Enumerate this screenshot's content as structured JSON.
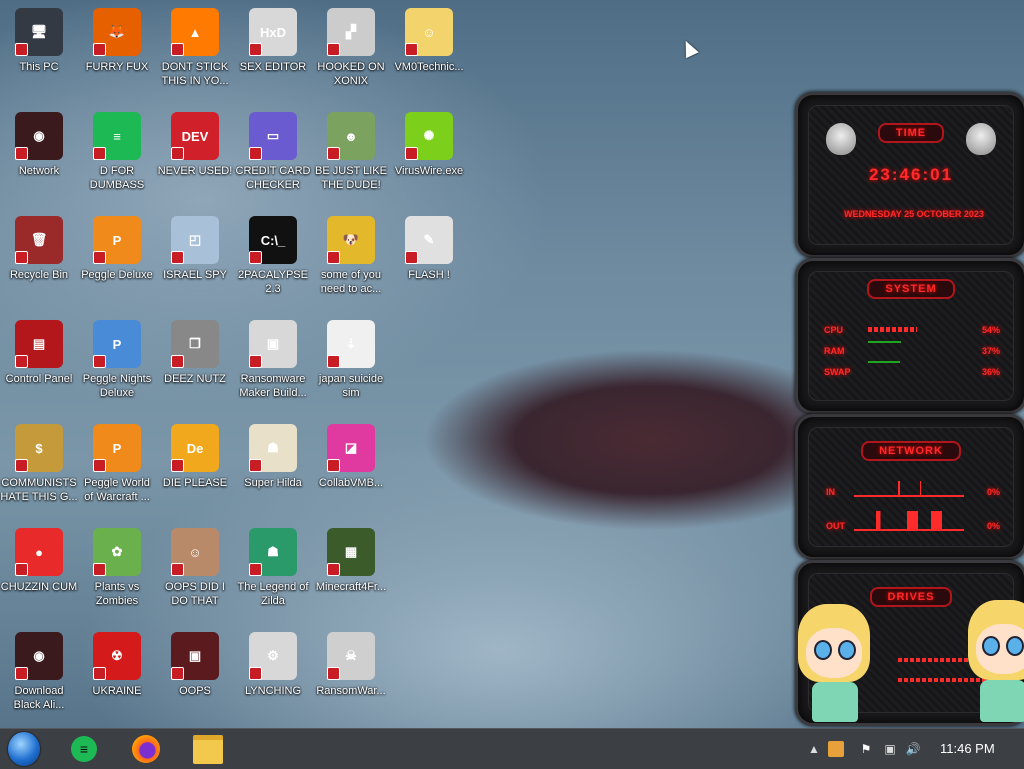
{
  "desktop_icons": [
    {
      "label": "This PC",
      "icon": "monitor-icon",
      "color": "#333a44",
      "glyph": "🖥"
    },
    {
      "label": "FURRY FUX",
      "icon": "firefox-icon",
      "color": "#e66000",
      "glyph": "🦊"
    },
    {
      "label": "DONT STICK THIS IN YO...",
      "icon": "traffic-cone-icon",
      "color": "#ff7a00",
      "glyph": "▲"
    },
    {
      "label": "SEX EDITOR",
      "icon": "hxd-icon",
      "color": "#d8d8d8",
      "glyph": "HxD"
    },
    {
      "label": "HOOKED ON XONIX",
      "icon": "xonix-icon",
      "color": "#cccccc",
      "glyph": "▞"
    },
    {
      "label": "VM0Technic...",
      "icon": "cartoon-icon",
      "color": "#f3d36b",
      "glyph": "☺"
    },
    {
      "label": "Network",
      "icon": "network-orb-icon",
      "color": "#3a1a1c",
      "glyph": "◉"
    },
    {
      "label": "D FOR DUMBASS",
      "icon": "discord-like-icon",
      "color": "#1db954",
      "glyph": "≡"
    },
    {
      "label": "NEVER USED!",
      "icon": "devcpp-icon",
      "color": "#d0212a",
      "glyph": "DEV"
    },
    {
      "label": "CREDIT CARD CHECKER",
      "icon": "credit-card-icon",
      "color": "#6b5bd0",
      "glyph": "▭"
    },
    {
      "label": "BE JUST LIKE THE DUDE!",
      "icon": "elf-icon",
      "color": "#7ba25f",
      "glyph": "☻"
    },
    {
      "label": "VirusWire.exe",
      "icon": "lime-icon",
      "color": "#7ccf1a",
      "glyph": "✺"
    },
    {
      "label": "Recycle Bin",
      "icon": "recycle-bin-icon",
      "color": "#9a2a2a",
      "glyph": "🗑"
    },
    {
      "label": "Peggle Deluxe",
      "icon": "peggle-icon",
      "color": "#f08a1a",
      "glyph": "P"
    },
    {
      "label": "ISRAEL SPY",
      "icon": "spy-icon",
      "color": "#a8c0d8",
      "glyph": "◰"
    },
    {
      "label": "2PACALYPSE 2.3",
      "icon": "terminal-icon",
      "color": "#111111",
      "glyph": "C:\\_"
    },
    {
      "label": "some of you need to ac...",
      "icon": "dog-icon",
      "color": "#e3b82a",
      "glyph": "🐶"
    },
    {
      "label": "FLASH !",
      "icon": "flash-icon",
      "color": "#e0e0e0",
      "glyph": "✎"
    },
    {
      "label": "Control Panel",
      "icon": "control-panel-icon",
      "color": "#b3161b",
      "glyph": "▤"
    },
    {
      "label": "Peggle Nights Deluxe",
      "icon": "peggle-nights-icon",
      "color": "#4a8bd8",
      "glyph": "P"
    },
    {
      "label": "DEEZ NUTZ",
      "icon": "copies-icon",
      "color": "#888888",
      "glyph": "❐"
    },
    {
      "label": "Ransomware Maker Build...",
      "icon": "window-icon",
      "color": "#d8d8d8",
      "glyph": "▣"
    },
    {
      "label": "japan suicide sim",
      "icon": "japan-icon",
      "color": "#f0f0f0",
      "glyph": "⇣"
    },
    {
      "label": "COMMUNISTS HATE THIS G...",
      "icon": "money-bag-icon",
      "color": "#c59a3a",
      "glyph": "$"
    },
    {
      "label": "Peggle World of Warcraft ...",
      "icon": "peggle-wow-icon",
      "color": "#f08a1a",
      "glyph": "P"
    },
    {
      "label": "DIE PLEASE",
      "icon": "de-icon",
      "color": "#f2a81c",
      "glyph": "De"
    },
    {
      "label": "Super Hilda",
      "icon": "pixel-char-icon",
      "color": "#e8e0c8",
      "glyph": "☗"
    },
    {
      "label": "CollabVMB...",
      "icon": "collab-icon",
      "color": "#e03aa0",
      "glyph": "◪"
    },
    {
      "label": "CHUZZIN CUM",
      "icon": "chuzzle-icon",
      "color": "#e82a2a",
      "glyph": "●"
    },
    {
      "label": "Plants vs Zombies",
      "icon": "plant-icon",
      "color": "#6ab04c",
      "glyph": "✿"
    },
    {
      "label": "OOPS DID I DO THAT",
      "icon": "portrait-icon",
      "color": "#b88a6a",
      "glyph": "☺"
    },
    {
      "label": "The Legend of Zilda",
      "icon": "zilda-icon",
      "color": "#2a9a6a",
      "glyph": "☗"
    },
    {
      "label": "Minecraft4Fr...",
      "icon": "grass-block-icon",
      "color": "#3b5b2a",
      "glyph": "▦"
    },
    {
      "label": "Download Black Ali...",
      "icon": "alien-orb-icon",
      "color": "#3a1a1c",
      "glyph": "◉"
    },
    {
      "label": "UKRAINE",
      "icon": "radiation-icon",
      "color": "#d41a1a",
      "glyph": "☢"
    },
    {
      "label": "OOPS",
      "icon": "oops-icon",
      "color": "#5a1a1e",
      "glyph": "▣"
    },
    {
      "label": "LYNCHING",
      "icon": "scp-icon",
      "color": "#d8d8d8",
      "glyph": "⚙"
    },
    {
      "label": "RansomWar...",
      "icon": "skull-icon",
      "color": "#cfcfcf",
      "glyph": "☠"
    }
  ],
  "widget": {
    "time_title": "TIME",
    "time": "23:46:01",
    "date": "WEDNESDAY 25 OCTOBER 2023",
    "system_title": "SYSTEM",
    "cpu_label": "CPU",
    "cpu_value": "54%",
    "cpu_fraction": 0.54,
    "ram_label": "RAM",
    "ram_value": "37%",
    "ram_fraction": 0.37,
    "swap_label": "SWAP",
    "swap_value": "36%",
    "swap_fraction": 0.36,
    "network_title": "NETWORK",
    "in_label": "IN",
    "in_value": "0%",
    "out_label": "OUT",
    "out_value": "0%",
    "drives_title": "DRIVES"
  },
  "taskbar": {
    "start_icon": "start-orb-icon",
    "pinned": [
      {
        "name": "notes-app-icon",
        "color": "#1db954"
      },
      {
        "name": "firefox-icon",
        "color": "#e66000"
      },
      {
        "name": "file-explorer-icon",
        "color": "#f2c94c"
      }
    ],
    "clock": "11:46 PM"
  },
  "colors": {
    "accent_red": "#ff2a2a",
    "taskbar": "#3c4044"
  }
}
